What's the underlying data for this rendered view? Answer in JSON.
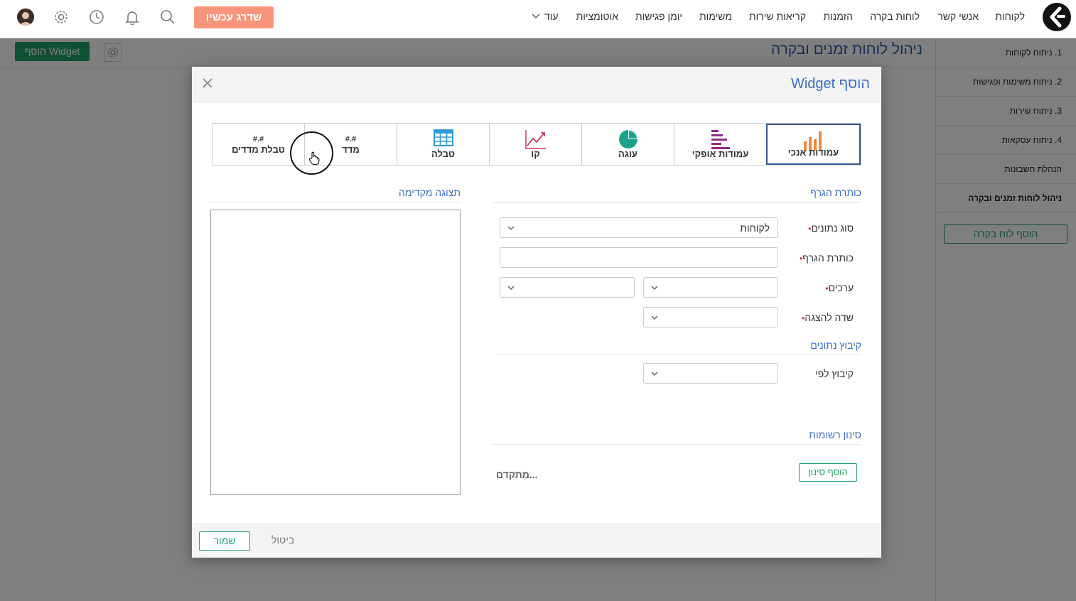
{
  "nav": {
    "items": [
      "לקוחות",
      "אנשי קשר",
      "לוחות בקרה",
      "הזמנות",
      "קריאות שירות",
      "משימות",
      "יומן פגישות",
      "אוטומציות"
    ],
    "more_label": "עוד",
    "upgrade_label": "שדרג עכשיו"
  },
  "page": {
    "title": "ניהול לוחות זמנים ובקרה",
    "add_widget_label": "הוסף Widget"
  },
  "sidebar": {
    "items": [
      {
        "label": "1. ניתוח לקוחות",
        "active": false
      },
      {
        "label": "2. ניתוח משימות ופגישות",
        "active": false
      },
      {
        "label": "3. ניתוח שירות",
        "active": false
      },
      {
        "label": "4. ניתוח עסקאות",
        "active": false
      },
      {
        "label": "הנהלת חשבונות",
        "active": false
      },
      {
        "label": "ניהול לוחות זמנים ובקרה",
        "active": true
      }
    ],
    "add_dashboard_label": "הוסף לוח בקרה"
  },
  "modal": {
    "title": "הוסף Widget",
    "chart_types": [
      {
        "label": "עמודות אנכי",
        "icon": "vertical-bars-icon",
        "selected": true
      },
      {
        "label": "עמודות אופקי",
        "icon": "horizontal-bars-icon",
        "selected": false
      },
      {
        "label": "עוגה",
        "icon": "pie-icon",
        "selected": false
      },
      {
        "label": "קו",
        "icon": "line-icon",
        "selected": false
      },
      {
        "label": "טבלה",
        "icon": "table-icon",
        "selected": false
      },
      {
        "label": "מדד",
        "hash": "#.#",
        "selected": false
      },
      {
        "label": "טבלת מדדים",
        "hash": "#.#",
        "selected": false
      }
    ],
    "graph_title_section": "כותרת הגרף",
    "fields": {
      "data_type_label": "סוג נתונים",
      "data_type_value": "לקוחות",
      "graph_title_label": "כותרת הגרף",
      "values_label": "ערכים",
      "display_field_label": "שדה להצגה"
    },
    "grouping_section": "קיבוץ נתונים",
    "group_by_label": "קיבוץ לפי",
    "filter_section": "סינון רשומות",
    "add_filter_label": "הוסף סינון",
    "advanced_label": "מתקדם...",
    "preview_title": "תצוגה מקדימה",
    "save_label": "שמור",
    "cancel_label": "ביטול"
  },
  "colors": {
    "accent_blue": "#3a6cc6",
    "green": "#23a06a",
    "upgrade": "#f8957a",
    "bars_orange": "#f0883e",
    "hbars_purple": "#8e2a8e",
    "pie_teal": "#1aa38a",
    "line_red": "#d23a5a",
    "table_blue": "#2f9ad8"
  }
}
